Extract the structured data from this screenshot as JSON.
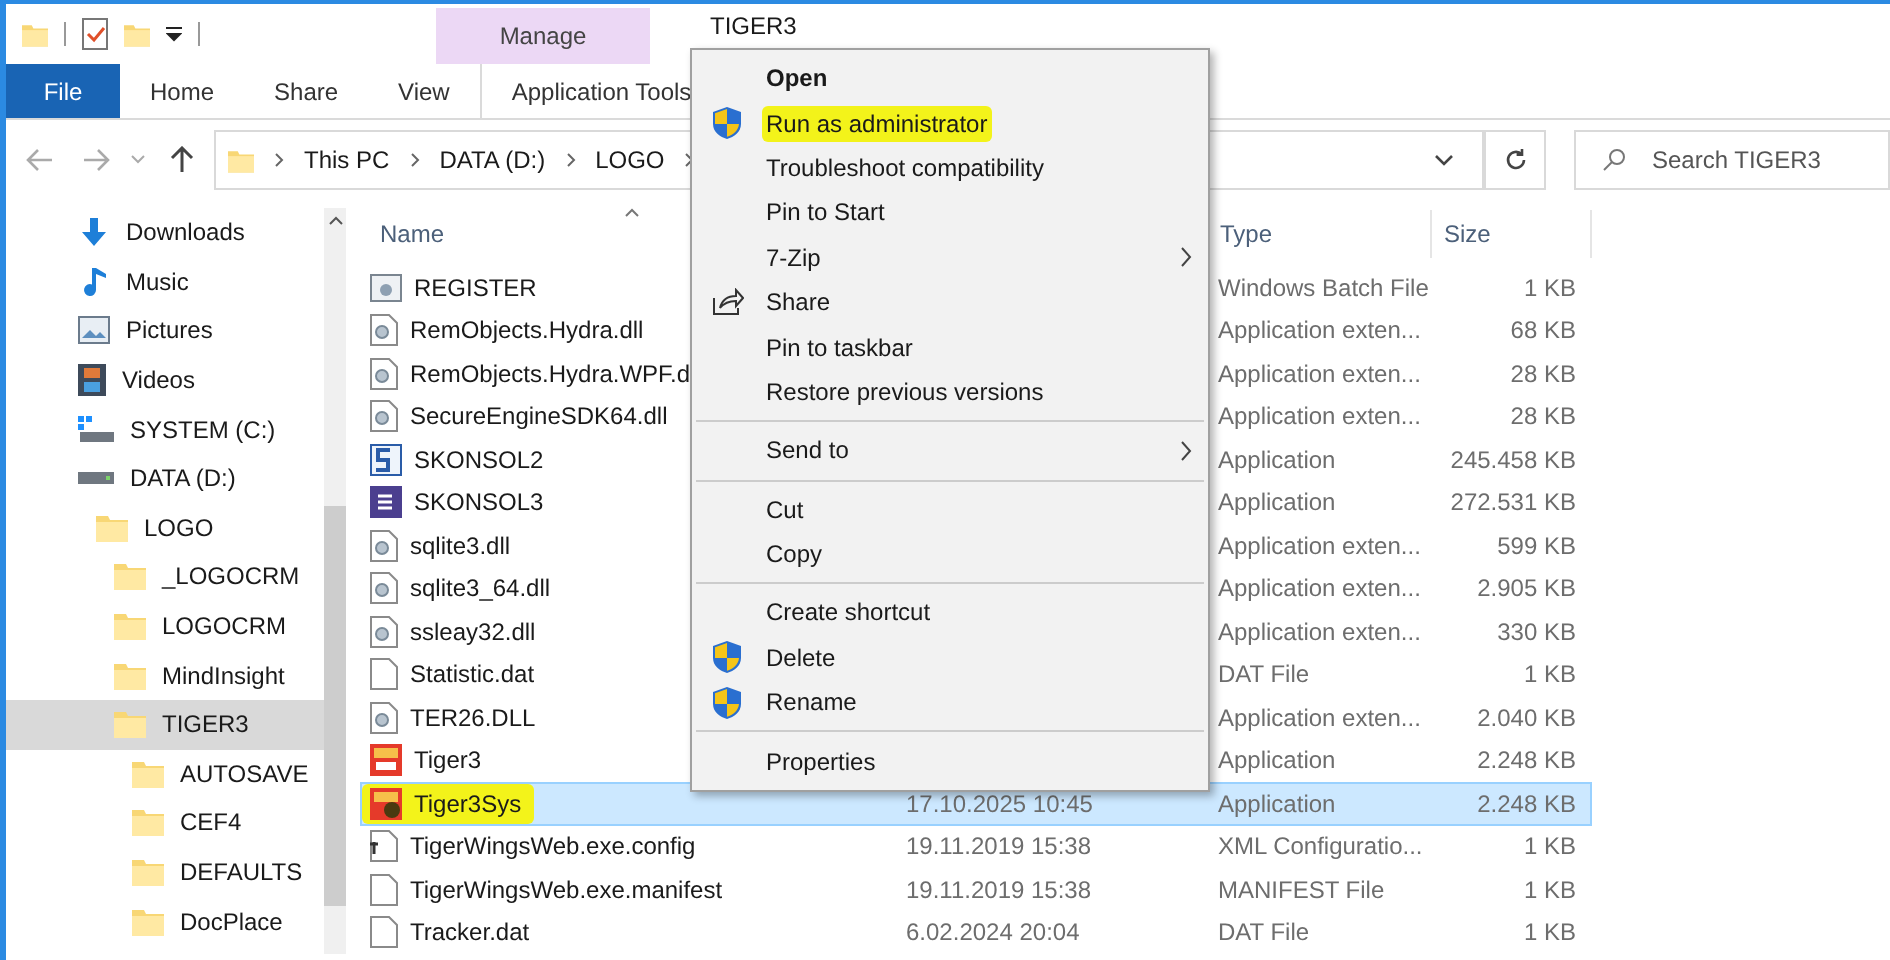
{
  "window": {
    "title": "TIGER3"
  },
  "ribbon": {
    "context_tab": "Manage",
    "tabs": [
      {
        "label": "File",
        "kind": "file",
        "selected": false
      },
      {
        "label": "Home",
        "kind": "tab",
        "selected": false
      },
      {
        "label": "Share",
        "kind": "tab",
        "selected": false
      },
      {
        "label": "View",
        "kind": "tab",
        "selected": false
      },
      {
        "label": "Application Tools",
        "kind": "tab",
        "selected": false
      }
    ]
  },
  "address_bar": {
    "path": [
      "This PC",
      "DATA (D:)",
      "LOGO"
    ]
  },
  "search": {
    "placeholder": "Search TIGER3"
  },
  "sidebar": {
    "items": [
      {
        "label": "Downloads",
        "kind": "downloads",
        "selected": false
      },
      {
        "label": "Music",
        "kind": "music",
        "selected": false
      },
      {
        "label": "Pictures",
        "kind": "pictures",
        "selected": false
      },
      {
        "label": "Videos",
        "kind": "videos",
        "selected": false
      },
      {
        "label": "SYSTEM (C:)",
        "kind": "system",
        "selected": false
      },
      {
        "label": "DATA (D:)",
        "kind": "drive",
        "selected": false,
        "children": [
          {
            "label": "LOGO",
            "kind": "folder",
            "selected": false,
            "children": [
              {
                "label": "_LOGOCRM",
                "kind": "folder",
                "selected": false
              },
              {
                "label": "LOGOCRM",
                "kind": "folder",
                "selected": false
              },
              {
                "label": "MindInsight",
                "kind": "folder",
                "selected": false
              },
              {
                "label": "TIGER3",
                "kind": "folder",
                "selected": true,
                "children": [
                  {
                    "label": "AUTOSAVE",
                    "kind": "folder",
                    "selected": false
                  },
                  {
                    "label": "CEF4",
                    "kind": "folder",
                    "selected": false
                  },
                  {
                    "label": "DEFAULTS",
                    "kind": "folder",
                    "selected": false
                  },
                  {
                    "label": "DocPlace",
                    "kind": "folder",
                    "selected": false
                  }
                ]
              }
            ]
          }
        ]
      }
    ]
  },
  "file_list": {
    "columns": [
      "Name",
      "Type",
      "Size"
    ],
    "rows": [
      {
        "name": "REGISTER",
        "kind": "batch",
        "type": "Windows Batch File",
        "size": "1 KB",
        "selected": false,
        "marked": false
      },
      {
        "name": "RemObjects.Hydra.dll",
        "kind": "dll",
        "type": "Application exten...",
        "size": "68 KB",
        "selected": false,
        "marked": false
      },
      {
        "name": "RemObjects.Hydra.WPF.d",
        "kind": "dll",
        "type": "Application exten...",
        "size": "28 KB",
        "selected": false,
        "marked": false
      },
      {
        "name": "SecureEngineSDK64.dll",
        "kind": "dll",
        "type": "Application exten...",
        "size": "28 KB",
        "selected": false,
        "marked": false
      },
      {
        "name": "SKONSOL2",
        "kind": "s2",
        "type": "Application",
        "size": "245.458 KB",
        "selected": false,
        "marked": false
      },
      {
        "name": "SKONSOL3",
        "kind": "s3",
        "type": "Application",
        "size": "272.531 KB",
        "selected": false,
        "marked": false
      },
      {
        "name": "sqlite3.dll",
        "kind": "dll",
        "type": "Application exten...",
        "size": "599 KB",
        "selected": false,
        "marked": false
      },
      {
        "name": "sqlite3_64.dll",
        "kind": "dll",
        "type": "Application exten...",
        "size": "2.905 KB",
        "selected": false,
        "marked": false
      },
      {
        "name": "ssleay32.dll",
        "kind": "dll",
        "type": "Application exten...",
        "size": "330 KB",
        "selected": false,
        "marked": false
      },
      {
        "name": "Statistic.dat",
        "kind": "file",
        "type": "DAT File",
        "size": "1 KB",
        "selected": false,
        "marked": false
      },
      {
        "name": "TER26.DLL",
        "kind": "dll",
        "type": "Application exten...",
        "size": "2.040 KB",
        "selected": false,
        "marked": false
      },
      {
        "name": "Tiger3",
        "kind": "tiger",
        "type": "Application",
        "size": "2.248 KB",
        "selected": false,
        "marked": false
      },
      {
        "name": "Tiger3Sys",
        "kind": "tigersys",
        "date": "17.10.2025 10:45",
        "type": "Application",
        "size": "2.248 KB",
        "selected": true,
        "marked": true
      },
      {
        "name": "TigerWingsWeb.exe.config",
        "kind": "config",
        "date": "19.11.2019 15:38",
        "type": "XML Configuratio...",
        "size": "1 KB",
        "selected": false,
        "marked": false
      },
      {
        "name": "TigerWingsWeb.exe.manifest",
        "kind": "file",
        "date": "19.11.2019 15:38",
        "type": "MANIFEST File",
        "size": "1 KB",
        "selected": false,
        "marked": false
      },
      {
        "name": "Tracker.dat",
        "kind": "file",
        "date": "6.02.2024 20:04",
        "type": "DAT File",
        "size": "1 KB",
        "selected": false,
        "marked": false
      }
    ]
  },
  "context_menu": {
    "items": [
      {
        "kind": "plain",
        "label": "Open",
        "default": true,
        "submenu": false,
        "marked": false
      },
      {
        "kind": "shield",
        "label": "Run as administrator",
        "default": false,
        "submenu": false,
        "marked": true
      },
      {
        "kind": "plain",
        "label": "Troubleshoot compatibility",
        "default": false,
        "submenu": false,
        "marked": false
      },
      {
        "kind": "plain",
        "label": "Pin to Start",
        "default": false,
        "submenu": false,
        "marked": false
      },
      {
        "kind": "plain",
        "label": "7-Zip",
        "default": false,
        "submenu": true,
        "marked": false
      },
      {
        "kind": "share",
        "label": "Share",
        "default": false,
        "submenu": false,
        "marked": false
      },
      {
        "kind": "plain",
        "label": "Pin to taskbar",
        "default": false,
        "submenu": false,
        "marked": false
      },
      {
        "kind": "plain",
        "label": "Restore previous versions",
        "default": false,
        "submenu": false,
        "marked": false
      },
      {
        "kind": "separator"
      },
      {
        "kind": "plain",
        "label": "Send to",
        "default": false,
        "submenu": true,
        "marked": false
      },
      {
        "kind": "separator"
      },
      {
        "kind": "plain",
        "label": "Cut",
        "default": false,
        "submenu": false,
        "marked": false
      },
      {
        "kind": "plain",
        "label": "Copy",
        "default": false,
        "submenu": false,
        "marked": false
      },
      {
        "kind": "separator"
      },
      {
        "kind": "plain",
        "label": "Create shortcut",
        "default": false,
        "submenu": false,
        "marked": false
      },
      {
        "kind": "shield",
        "label": "Delete",
        "default": false,
        "submenu": false,
        "marked": false
      },
      {
        "kind": "shield",
        "label": "Rename",
        "default": false,
        "submenu": false,
        "marked": false
      },
      {
        "kind": "separator"
      },
      {
        "kind": "plain",
        "label": "Properties",
        "default": false,
        "submenu": false,
        "marked": false
      }
    ]
  }
}
